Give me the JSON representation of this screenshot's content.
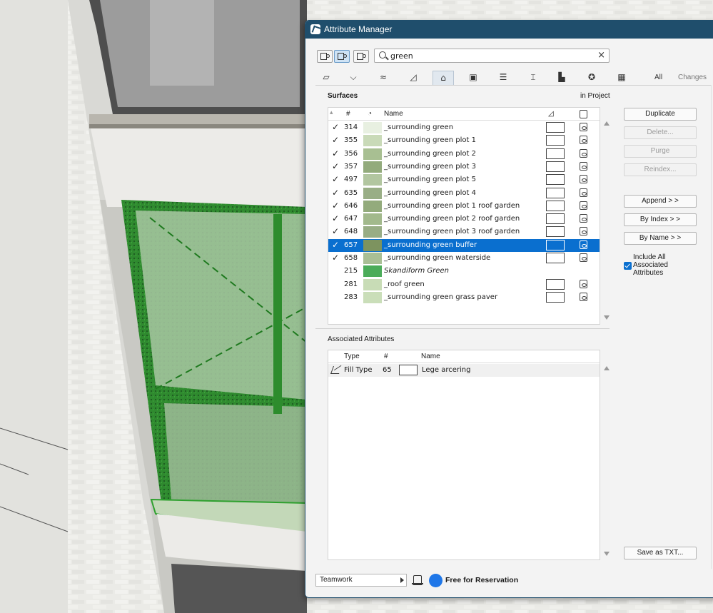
{
  "window": {
    "title": "Attribute Manager"
  },
  "search": {
    "value": "green"
  },
  "toolbar": {
    "clear_glyph": "×"
  },
  "type_tabs": {
    "all_label": "All",
    "changes_label": "Changes",
    "icons": [
      "surface-fill-icon",
      "pen-icon",
      "line-type-icon",
      "fill-type-icon",
      "surface-brush-icon",
      "building-material-icon",
      "composite-icon",
      "profile-icon",
      "zone-icon",
      "mep-icon",
      "grid-icon"
    ]
  },
  "surfaces": {
    "title": "Surfaces",
    "scope_label": "in Project",
    "columns": {
      "num": "#",
      "name": "Name"
    },
    "rows": [
      {
        "checked": true,
        "num": "314",
        "name": "_surrounding green",
        "color": "#e8f0e1",
        "selected": false,
        "italic": false,
        "has_fill": true
      },
      {
        "checked": true,
        "num": "355",
        "name": "_surrounding green plot 1",
        "color": "#c9dab8",
        "selected": false,
        "italic": false,
        "has_fill": true
      },
      {
        "checked": true,
        "num": "356",
        "name": "_surrounding green plot 2",
        "color": "#a8bf92",
        "selected": false,
        "italic": false,
        "has_fill": true
      },
      {
        "checked": true,
        "num": "357",
        "name": "_surrounding green plot 3",
        "color": "#93ab7c",
        "selected": false,
        "italic": false,
        "has_fill": true
      },
      {
        "checked": true,
        "num": "497",
        "name": "_surrounding green plot 5",
        "color": "#b2c6a0",
        "selected": false,
        "italic": false,
        "has_fill": true
      },
      {
        "checked": true,
        "num": "635",
        "name": "_surrounding green plot 4",
        "color": "#99ae86",
        "selected": false,
        "italic": false,
        "has_fill": true
      },
      {
        "checked": true,
        "num": "646",
        "name": "_surrounding green plot 1 roof garden",
        "color": "#93ab7c",
        "selected": false,
        "italic": false,
        "has_fill": true
      },
      {
        "checked": true,
        "num": "647",
        "name": "_surrounding green plot 2 roof garden",
        "color": "#a2b98c",
        "selected": false,
        "italic": false,
        "has_fill": true
      },
      {
        "checked": true,
        "num": "648",
        "name": "_surrounding green plot 3 roof garden",
        "color": "#98ad85",
        "selected": false,
        "italic": false,
        "has_fill": true
      },
      {
        "checked": true,
        "num": "657",
        "name": "_surrounding green buffer",
        "color": "#7d935f",
        "selected": true,
        "italic": false,
        "has_fill": true
      },
      {
        "checked": true,
        "num": "658",
        "name": "_surrounding green waterside",
        "color": "#a9bf95",
        "selected": false,
        "italic": false,
        "has_fill": true
      },
      {
        "checked": false,
        "num": "215",
        "name": "Skandiform Green",
        "color": "#4bac59",
        "selected": false,
        "italic": true,
        "has_fill": false
      },
      {
        "checked": false,
        "num": "281",
        "name": "_roof green",
        "color": "#c8dcb6",
        "selected": false,
        "italic": false,
        "has_fill": true
      },
      {
        "checked": false,
        "num": "283",
        "name": "_surrounding green grass paver",
        "color": "#cadeb9",
        "selected": false,
        "italic": false,
        "has_fill": true
      }
    ]
  },
  "associated": {
    "title": "Associated Attributes",
    "columns": {
      "type": "Type",
      "num": "#",
      "name": "Name"
    },
    "rows": [
      {
        "type": "Fill Type",
        "num": "65",
        "name": "Lege arcering"
      }
    ]
  },
  "buttons": {
    "duplicate": "Duplicate",
    "delete": "Delete...",
    "purge": "Purge",
    "reindex": "Reindex...",
    "append": "Append > >",
    "by_index": "By Index > >",
    "by_name": "By Name > >",
    "include_all": "Include All Associated Attributes",
    "save_txt": "Save as TXT..."
  },
  "bottom": {
    "teamwork": "Teamwork",
    "status": "Free for Reservation"
  },
  "colors": {
    "titlebar": "#1f4e6c",
    "selection": "#0a6fcf",
    "status_dot": "#1f77e8"
  }
}
